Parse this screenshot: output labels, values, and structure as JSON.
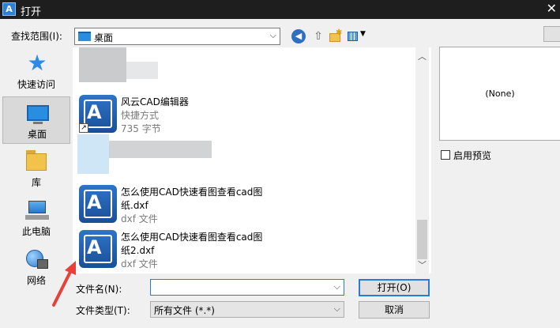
{
  "window": {
    "title": "打开",
    "app_icon_letter": "A"
  },
  "lookin": {
    "label": "查找范围(I):",
    "value": "桌面"
  },
  "places": [
    {
      "label": "快速访问",
      "icon": "star-icon"
    },
    {
      "label": "桌面",
      "icon": "desktop-icon"
    },
    {
      "label": "库",
      "icon": "library-icon"
    },
    {
      "label": "此电脑",
      "icon": "computer-icon"
    },
    {
      "label": "网络",
      "icon": "network-icon"
    }
  ],
  "files": [
    {
      "name": "风云CAD编辑器",
      "line2": "快捷方式",
      "line3": "735 字节",
      "icon": "cad-shortcut-icon"
    },
    {
      "name": "怎么使用CAD快速看图查看cad图",
      "line2": "纸.dxf",
      "line3": "dxf 文件",
      "icon": "cad-file-icon"
    },
    {
      "name": "怎么使用CAD快速看图查看cad图",
      "line2": "纸2.dxf",
      "line3": "dxf 文件",
      "icon": "cad-file-icon"
    }
  ],
  "preview": {
    "text": "(None)",
    "checkbox_label": "启用预览",
    "checked": false
  },
  "bottom": {
    "filename_label": "文件名(N):",
    "filename_value": "",
    "filetype_label": "文件类型(T):",
    "filetype_value": "所有文件 (*.*)",
    "open_button": "打开(O)",
    "cancel_button": "取消"
  },
  "colors": {
    "accent": "#2a7bd8",
    "titlebar": "#1e1e1e",
    "annotation": "#e8403a"
  }
}
